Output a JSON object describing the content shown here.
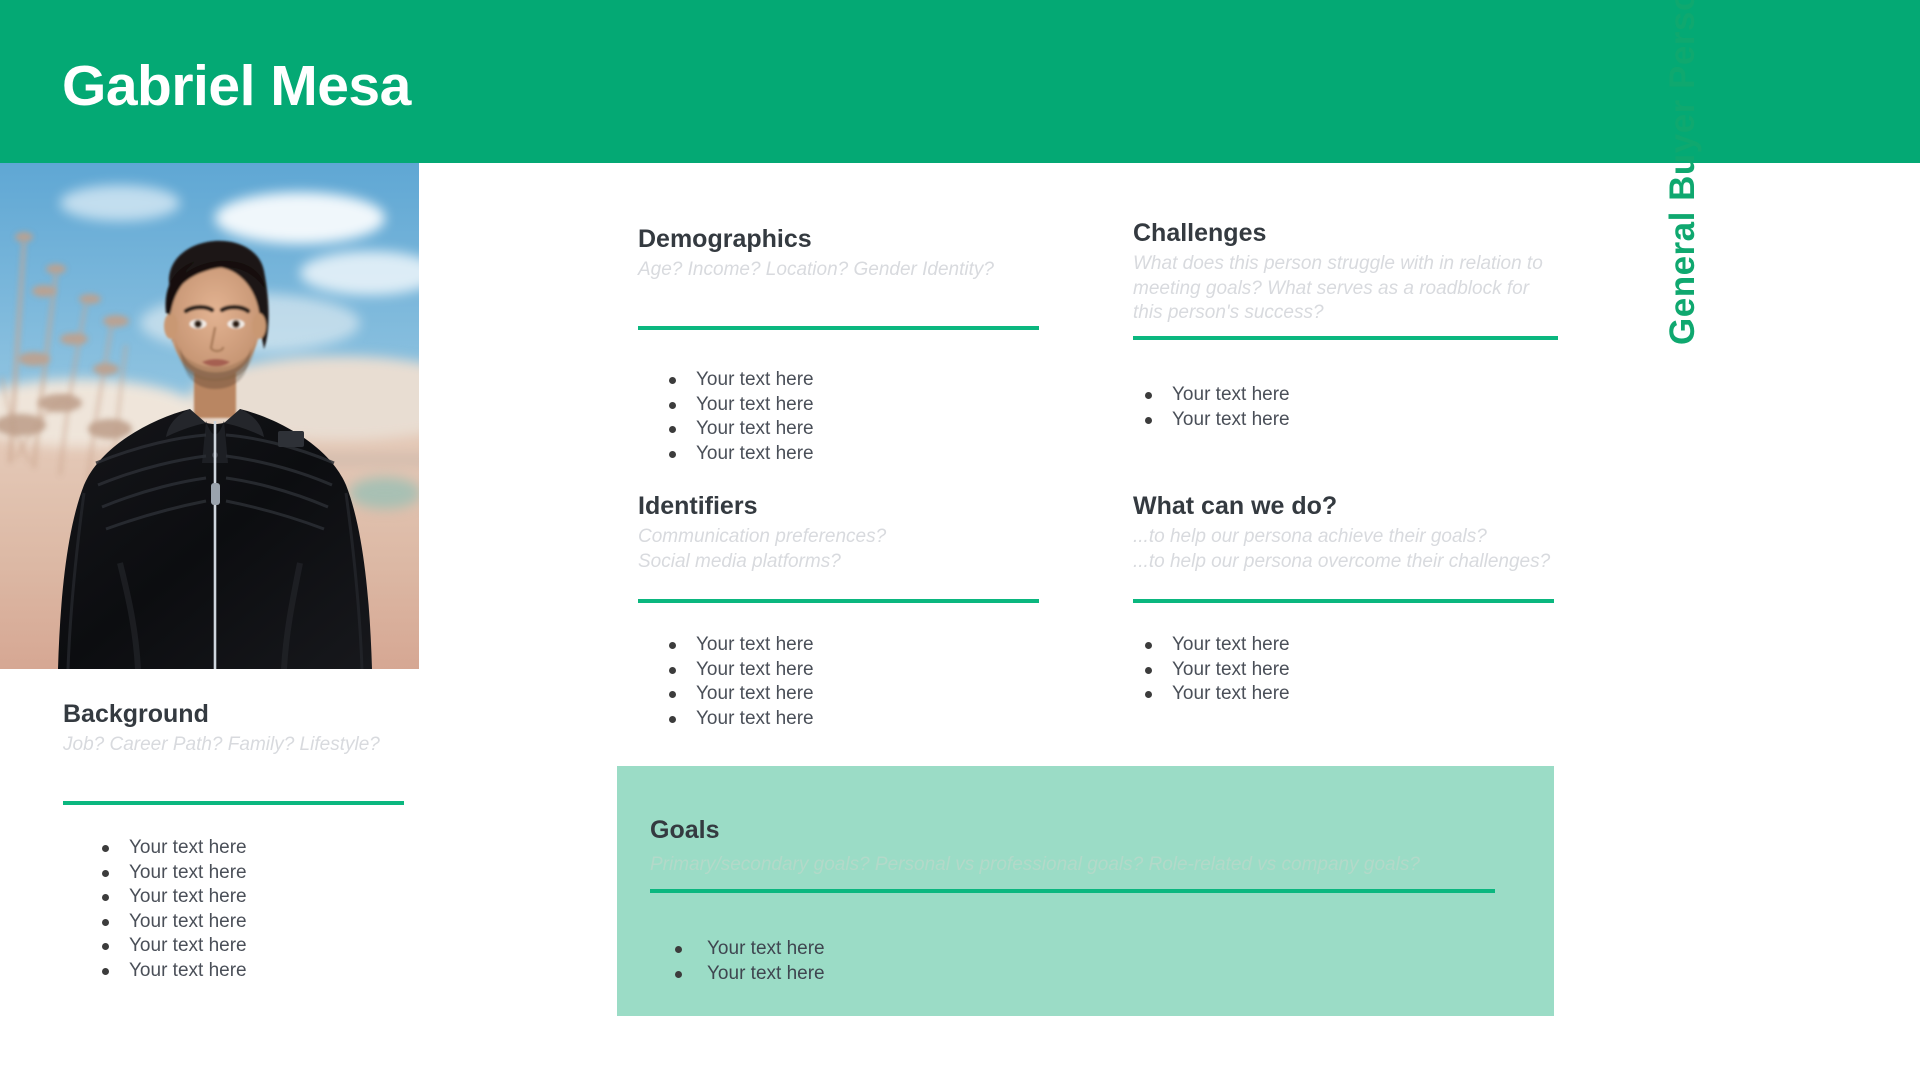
{
  "header": {
    "persona_name": "Gabriel Mesa",
    "banner_color": "#04A974"
  },
  "portrait": {
    "alt": "portrait-photo-of-young-man-in-black-jacket-outdoors",
    "subject": "young man with dark hair wearing a black zip-up jacket",
    "background_scene": "blue sky with clouds and blurred dry grass desert landscape"
  },
  "side_label": {
    "text": "General Buyer Persona",
    "color": "#0FA86F"
  },
  "theme": {
    "rule_color": "#0BB77F",
    "goals_panel_color": "#9BDCC6",
    "heading_color": "#343a40",
    "subtitle_color": "#d8dade",
    "bullet_text_color": "#4a4f58"
  },
  "sections": {
    "background": {
      "title": "Background",
      "subtitle": "Job? Career Path? Family? Lifestyle?",
      "bullets": [
        "Your text here",
        "Your text here",
        "Your text here",
        "Your text here",
        "Your text here",
        "Your text here"
      ]
    },
    "demographics": {
      "title": "Demographics",
      "subtitle": "Age? Income? Location? Gender Identity?",
      "bullets": [
        "Your text here",
        "Your text here",
        "Your text here",
        "Your text here"
      ]
    },
    "challenges": {
      "title": "Challenges",
      "subtitle": "What does this person struggle with in relation to meeting goals? What serves as a roadblock for this person's success?",
      "bullets": [
        "Your text here",
        "Your text here"
      ]
    },
    "identifiers": {
      "title": "Identifiers",
      "subtitle": "Communication preferences?\nSocial media platforms?",
      "bullets": [
        "Your text here",
        "Your text here",
        "Your text here",
        "Your text here"
      ]
    },
    "what_can_we_do": {
      "title": "What can we do?",
      "subtitle": "...to help our persona achieve their goals?\n...to help our persona overcome their challenges?",
      "bullets": [
        "Your text here",
        "Your text here",
        "Your text here"
      ]
    },
    "goals": {
      "title": "Goals",
      "subtitle": "Primary/secondary goals?  Personal vs professional goals? Role-related vs company goals?",
      "bullets": [
        "Your text here",
        "Your text here"
      ]
    }
  }
}
